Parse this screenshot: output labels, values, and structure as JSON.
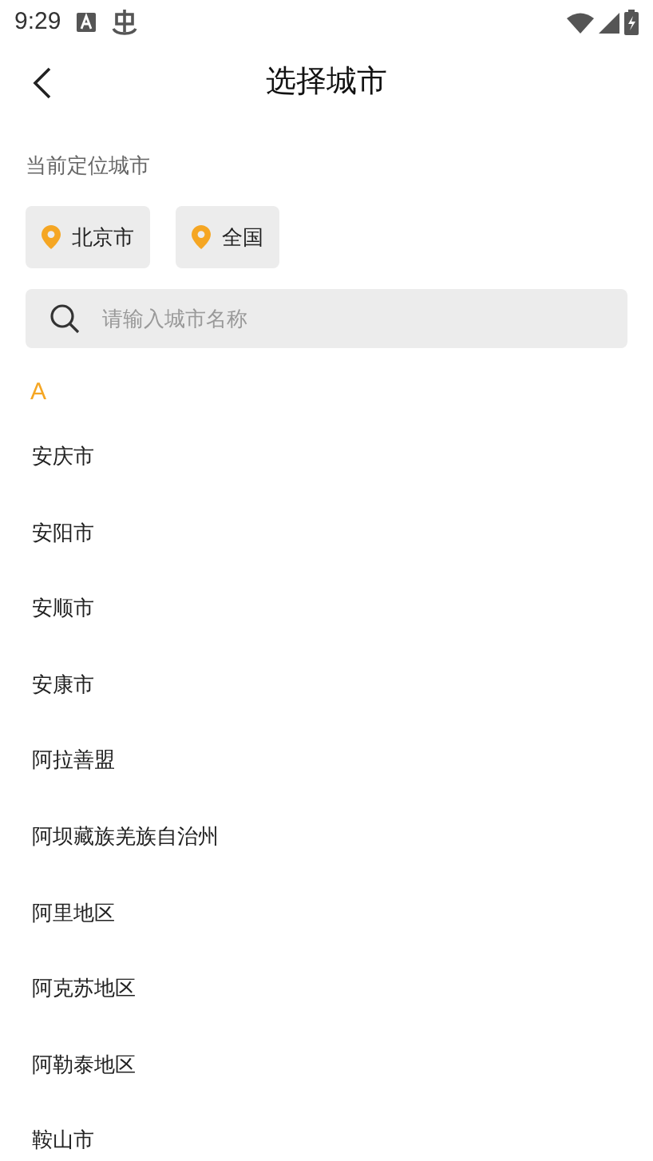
{
  "status_bar": {
    "time": "9:29"
  },
  "header": {
    "title": "选择城市"
  },
  "current_location": {
    "label": "当前定位城市",
    "chips": [
      {
        "label": "北京市"
      },
      {
        "label": "全国"
      }
    ]
  },
  "search": {
    "placeholder": "请输入城市名称"
  },
  "section": {
    "letter": "A",
    "cities": [
      "安庆市",
      "安阳市",
      "安顺市",
      "安康市",
      "阿拉善盟",
      "阿坝藏族羌族自治州",
      "阿里地区",
      "阿克苏地区",
      "阿勒泰地区",
      "鞍山市"
    ]
  }
}
